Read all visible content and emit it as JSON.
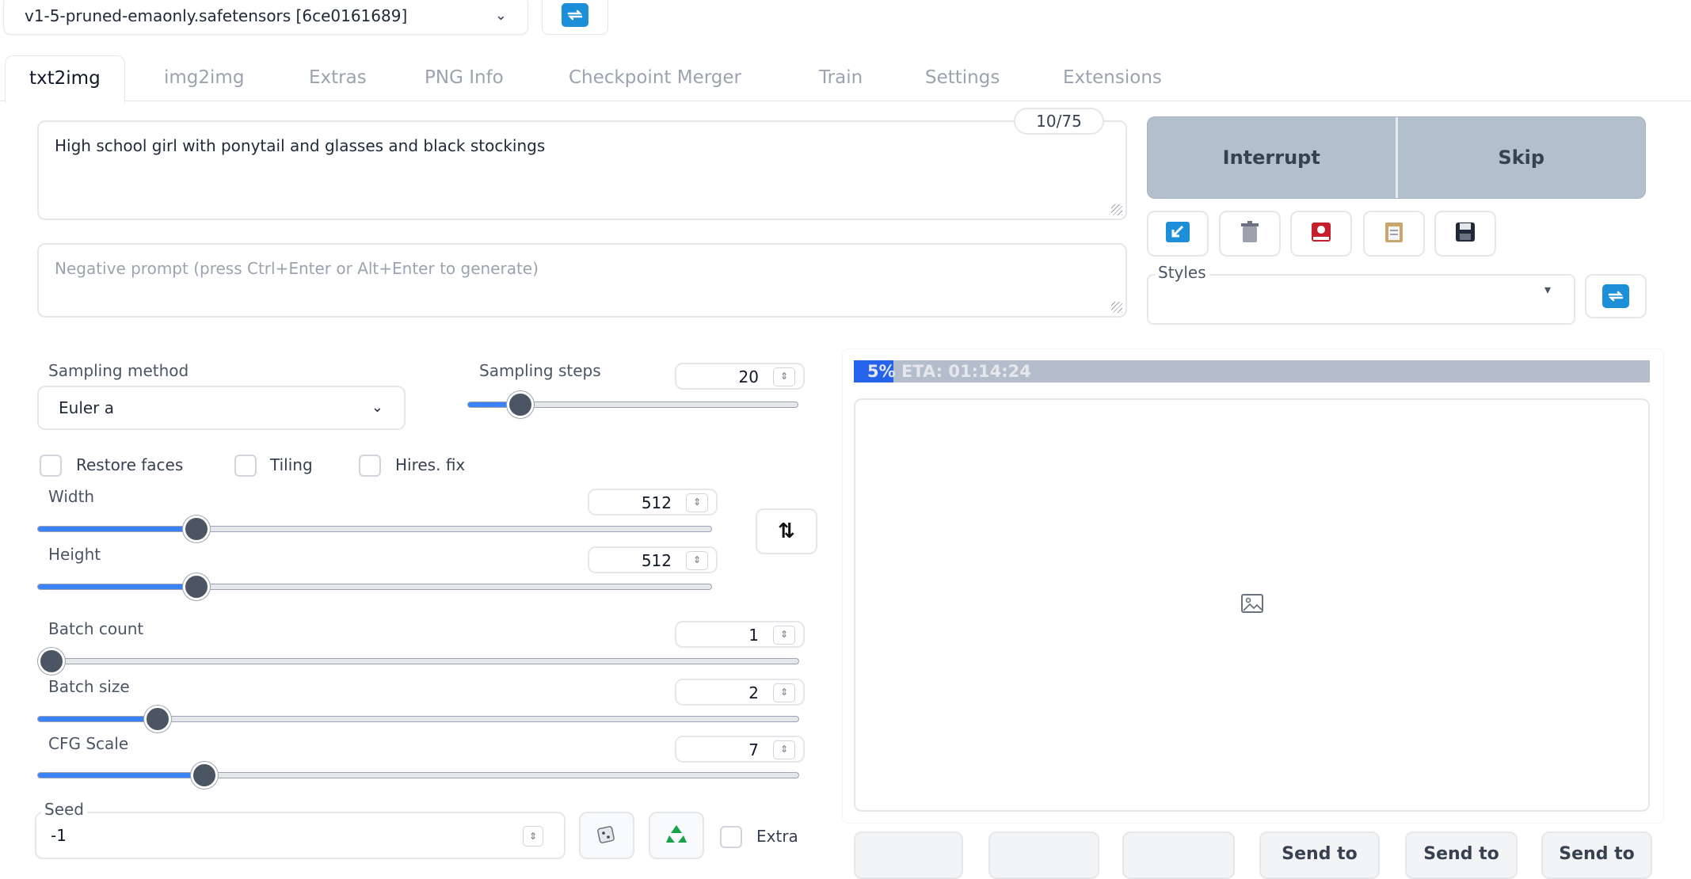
{
  "checkpoint": {
    "value": "v1-5-pruned-emaonly.safetensors [6ce0161689]"
  },
  "tabs": [
    {
      "label": "txt2img",
      "active": true
    },
    {
      "label": "img2img"
    },
    {
      "label": "Extras"
    },
    {
      "label": "PNG Info"
    },
    {
      "label": "Checkpoint Merger"
    },
    {
      "label": "Train"
    },
    {
      "label": "Settings"
    },
    {
      "label": "Extensions"
    }
  ],
  "prompt": {
    "value": "High school girl with ponytail and glasses and black stockings",
    "token_count": "10/75"
  },
  "negative_prompt": {
    "placeholder": "Negative prompt (press Ctrl+Enter or Alt+Enter to generate)"
  },
  "generate": {
    "interrupt_label": "Interrupt",
    "skip_label": "Skip"
  },
  "tool_icons": [
    "arrow-down-left-icon",
    "trash-icon",
    "red-card-icon",
    "clipboard-icon",
    "save-icon"
  ],
  "styles": {
    "label": "Styles",
    "value": ""
  },
  "sampling": {
    "method_label": "Sampling method",
    "method_value": "Euler a",
    "steps_label": "Sampling steps",
    "steps_value": "20"
  },
  "checkboxes": {
    "restore_faces": "Restore faces",
    "tiling": "Tiling",
    "hires_fix": "Hires. fix"
  },
  "width": {
    "label": "Width",
    "value": "512"
  },
  "height": {
    "label": "Height",
    "value": "512"
  },
  "swap_icon_text": "⇅",
  "batch_count": {
    "label": "Batch count",
    "value": "1"
  },
  "batch_size": {
    "label": "Batch size",
    "value": "2"
  },
  "cfg_scale": {
    "label": "CFG Scale",
    "value": "7"
  },
  "seed": {
    "label": "Seed",
    "value": "-1",
    "extra_label": "Extra"
  },
  "progress": {
    "percent": 5,
    "text": "5% ETA: 01:14:24"
  },
  "output_buttons": [
    "",
    "",
    "",
    "Send to",
    "Send to",
    "Send to"
  ],
  "colors": {
    "accent": "#3b82f6",
    "progress": "#2563eb",
    "generate_bg": "#b4bfcc"
  }
}
